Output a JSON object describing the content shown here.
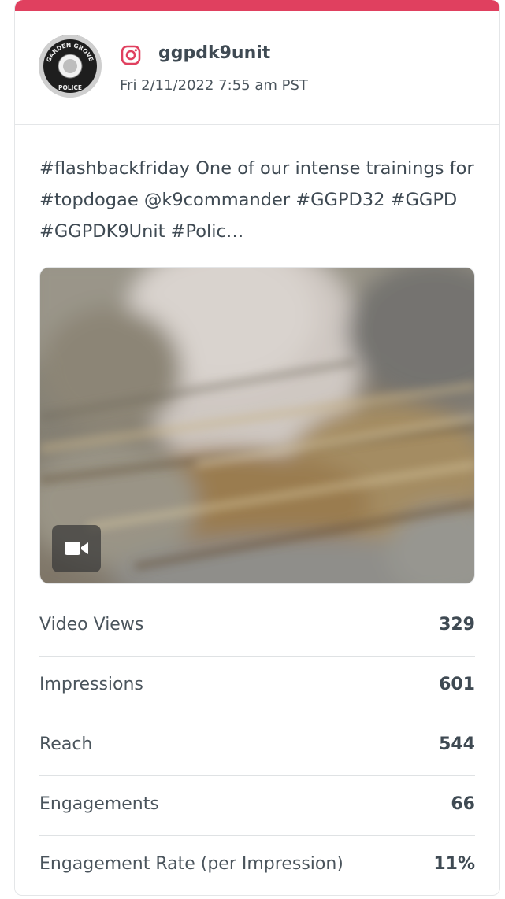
{
  "post": {
    "username": "ggpdk9unit",
    "timestamp": "Fri 2/11/2022 7:55 am PST",
    "caption": "#flashbackfriday One of our intense trainings for #topdogae @k9commander #GGPD32 #GGPD #GGPDK9Unit #Polic…",
    "network_icon": "instagram-icon",
    "media_type_icon": "video-camera-icon",
    "avatar_badge": {
      "top_text": "GARDEN GROVE",
      "bottom_text": "POLICE"
    }
  },
  "colors": {
    "accent": "#e0405f",
    "text_primary": "#3f4a53",
    "text_secondary": "#4a545c",
    "divider": "#dfe2e4"
  },
  "metrics": [
    {
      "label": "Video Views",
      "value": "329"
    },
    {
      "label": "Impressions",
      "value": "601"
    },
    {
      "label": "Reach",
      "value": "544"
    },
    {
      "label": "Engagements",
      "value": "66"
    },
    {
      "label": "Engagement Rate (per Impression)",
      "value": "11%"
    }
  ]
}
